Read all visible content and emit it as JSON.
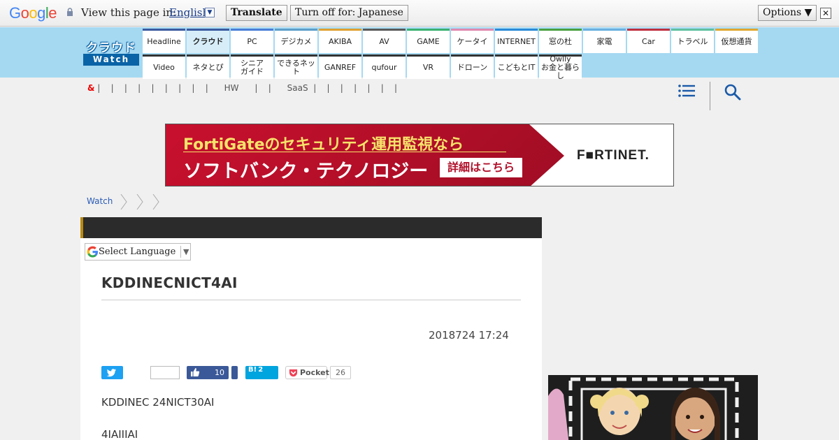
{
  "translate_bar": {
    "logo": "Google",
    "view_label": "View this page in:",
    "language": "English",
    "translate_button": "Translate",
    "turn_off_button": "Turn off for: Japanese",
    "options_button": "Options ▼",
    "close": "✕"
  },
  "header": {
    "logo_top": "クラウド",
    "logo_bottom": "Watch",
    "nav_row1": [
      {
        "label": "Headline",
        "color": "#3b5aa0"
      },
      {
        "label": "クラウド",
        "color": "#3b5aa0",
        "active": true
      },
      {
        "label": "PC",
        "color": "#4a7fd8"
      },
      {
        "label": "デジカメ",
        "color": "#5d9ec9"
      },
      {
        "label": "AKIBA",
        "color": "#e0a030"
      },
      {
        "label": "AV",
        "color": "#5a5a5a"
      },
      {
        "label": "GAME",
        "color": "#3ab070"
      },
      {
        "label": "ケータイ",
        "color": "#e08ab0"
      },
      {
        "label": "INTERNET",
        "color": "#2a8ad8"
      },
      {
        "label": "窓の杜",
        "color": "#4aa040"
      },
      {
        "label": "家電",
        "color": "#6ab0e0"
      },
      {
        "label": "Car",
        "color": "#c03040"
      },
      {
        "label": "トラベル",
        "color": "#60c0a0"
      },
      {
        "label": "仮想通貨",
        "color": "#e0a830"
      }
    ],
    "nav_row2": [
      {
        "label": "Video"
      },
      {
        "label": "ネタとぴ"
      },
      {
        "label": "シニア\nガイド"
      },
      {
        "label": "できるネット"
      },
      {
        "label": "GANREF"
      },
      {
        "label": "qufour"
      },
      {
        "label": "VR"
      },
      {
        "label": "ドローン"
      },
      {
        "label": "こどもとIT"
      },
      {
        "label": "Owlly\nお金と暮らし"
      }
    ]
  },
  "subnav": {
    "text_amp": "&",
    "text_rest": " |    |    |    |    |    |    |    |    |      HW      |    |      SaaS  |    |    |    |    |    |    |"
  },
  "ad": {
    "line1": "FortiGateのセキュリティ運用監視なら",
    "line2": "ソフトバンク・テクノロジー",
    "cta": "詳細はこちら",
    "brand": "F■RTINET."
  },
  "breadcrumb": {
    "first": "Watch"
  },
  "article": {
    "select_language": "Select Language",
    "title": "KDDINECNICT4AI",
    "date": "2018724 17:24",
    "fb_like_count": "10",
    "hatena_label": "B!",
    "hatena_count": "2",
    "pocket_label": "Pocket",
    "pocket_count": "26",
    "para1": "KDDINEC 24NICT30AI",
    "para2": "4IAIIIAI"
  }
}
